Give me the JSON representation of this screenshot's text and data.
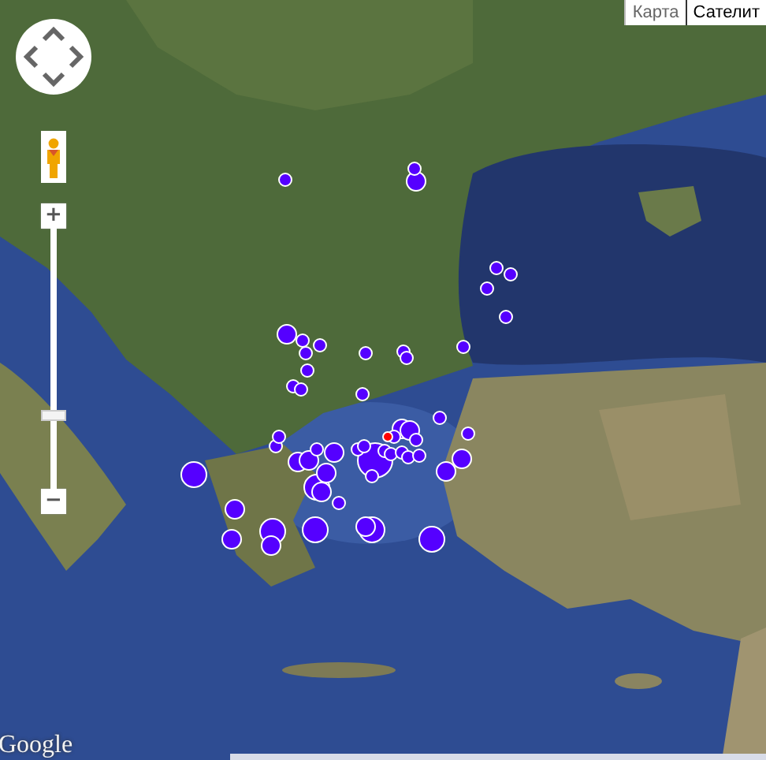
{
  "map_type_buttons": [
    {
      "label": "Карта",
      "selected": false
    },
    {
      "label": "Сателит",
      "selected": true
    }
  ],
  "zoom": {
    "plus": "+",
    "minus": "−",
    "level": 0.28
  },
  "markers": [
    {
      "kind": "small",
      "color": "#5500ff"
    },
    {
      "kind": "small",
      "color": "#5500ff"
    },
    {
      "kind": "medium",
      "color": "#5500ff"
    },
    {
      "kind": "small",
      "color": "#5500ff"
    },
    {
      "kind": "small",
      "color": "#5500ff"
    },
    {
      "kind": "small",
      "color": "#5500ff"
    },
    {
      "kind": "small",
      "color": "#5500ff"
    },
    {
      "kind": "small",
      "color": "#5500ff"
    },
    {
      "kind": "medium",
      "color": "#5500ff"
    },
    {
      "kind": "small",
      "color": "#5500ff"
    },
    {
      "kind": "small",
      "color": "#5500ff"
    },
    {
      "kind": "small",
      "color": "#5500ff"
    },
    {
      "kind": "small",
      "color": "#5500ff"
    },
    {
      "kind": "small",
      "color": "#5500ff"
    },
    {
      "kind": "small",
      "color": "#5500ff"
    },
    {
      "kind": "small",
      "color": "#5500ff"
    },
    {
      "kind": "small",
      "color": "#5500ff"
    },
    {
      "kind": "small",
      "color": "#5500ff"
    },
    {
      "kind": "small",
      "color": "#5500ff"
    },
    {
      "kind": "small",
      "color": "#5500ff"
    },
    {
      "kind": "small",
      "color": "#5500ff"
    },
    {
      "kind": "small",
      "color": "#5500ff"
    },
    {
      "kind": "small",
      "color": "#5500ff"
    },
    {
      "kind": "large",
      "color": "#5500ff"
    },
    {
      "kind": "medium",
      "color": "#5500ff"
    },
    {
      "kind": "medium",
      "color": "#5500ff"
    },
    {
      "kind": "medium",
      "color": "#5500ff"
    },
    {
      "kind": "small",
      "color": "#5500ff"
    },
    {
      "kind": "medium",
      "color": "#5500ff"
    },
    {
      "kind": "large",
      "color": "#5500ff"
    },
    {
      "kind": "medium",
      "color": "#5500ff"
    },
    {
      "kind": "small",
      "color": "#5500ff"
    },
    {
      "kind": "small",
      "color": "#5500ff"
    },
    {
      "kind": "small",
      "color": "#5500ff"
    },
    {
      "kind": "huge",
      "color": "#5500ff"
    },
    {
      "kind": "small",
      "color": "#5500ff"
    },
    {
      "kind": "small",
      "color": "#5500ff"
    },
    {
      "kind": "medium",
      "color": "#5500ff"
    },
    {
      "kind": "medium",
      "color": "#5500ff"
    },
    {
      "kind": "small",
      "color": "#5500ff"
    },
    {
      "kind": "small",
      "color": "#5500ff"
    },
    {
      "kind": "small",
      "color": "#5500ff"
    },
    {
      "kind": "small",
      "color": "#5500ff"
    },
    {
      "kind": "small",
      "color": "#5500ff"
    },
    {
      "kind": "small",
      "color": "#5500ff"
    },
    {
      "kind": "medium",
      "color": "#5500ff"
    },
    {
      "kind": "medium",
      "color": "#5500ff"
    },
    {
      "kind": "medium",
      "color": "#5500ff"
    },
    {
      "kind": "medium",
      "color": "#5500ff"
    },
    {
      "kind": "large",
      "color": "#5500ff"
    },
    {
      "kind": "medium",
      "color": "#5500ff"
    },
    {
      "kind": "large",
      "color": "#5500ff"
    },
    {
      "kind": "medium",
      "color": "#5500ff"
    },
    {
      "kind": "large",
      "color": "#5500ff"
    },
    {
      "kind": "large",
      "color": "#5500ff"
    },
    {
      "kind": "tiny",
      "color": "#ff0000"
    }
  ],
  "logo": "Google"
}
